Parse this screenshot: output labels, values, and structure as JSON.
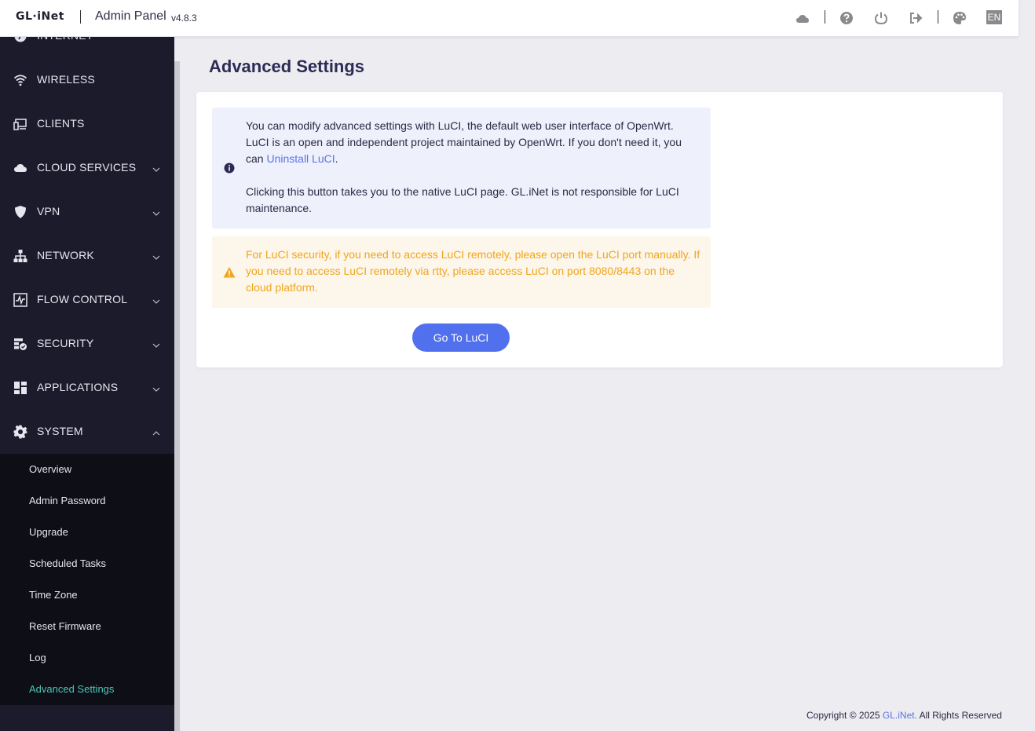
{
  "header": {
    "logo": "GL·iNet",
    "title": "Admin Panel",
    "version": "v4.8.3",
    "language": "EN"
  },
  "sidebar": {
    "items": [
      {
        "label": "INTERNET",
        "icon": "globe-icon",
        "has_chevron": false
      },
      {
        "label": "WIRELESS",
        "icon": "wifi-icon",
        "has_chevron": false
      },
      {
        "label": "CLIENTS",
        "icon": "devices-icon",
        "has_chevron": false
      },
      {
        "label": "CLOUD SERVICES",
        "icon": "cloud-icon",
        "has_chevron": true
      },
      {
        "label": "VPN",
        "icon": "shield-icon",
        "has_chevron": true
      },
      {
        "label": "NETWORK",
        "icon": "network-icon",
        "has_chevron": true
      },
      {
        "label": "FLOW CONTROL",
        "icon": "flow-icon",
        "has_chevron": true
      },
      {
        "label": "SECURITY",
        "icon": "firewall-icon",
        "has_chevron": true
      },
      {
        "label": "APPLICATIONS",
        "icon": "apps-icon",
        "has_chevron": true
      },
      {
        "label": "SYSTEM",
        "icon": "gear-icon",
        "has_chevron": true,
        "expanded": true
      }
    ],
    "system_submenu": [
      "Overview",
      "Admin Password",
      "Upgrade",
      "Scheduled Tasks",
      "Time Zone",
      "Reset Firmware",
      "Log",
      "Advanced Settings"
    ],
    "active_submenu": "Advanced Settings"
  },
  "main": {
    "title": "Advanced Settings",
    "info": {
      "p1_before": "You can modify advanced settings with LuCI, the default web user interface of OpenWrt. LuCI is an open and independent project maintained by OpenWrt. If you don't need it, you can ",
      "p1_link": "Uninstall LuCI",
      "p1_after": ".",
      "p2": "Clicking this button takes you to the native LuCI page. GL.iNet is not responsible for LuCI maintenance."
    },
    "warning": "For LuCI security, if you need to access LuCI remotely, please open the LuCI port manually. If you need to access LuCI remotely via rtty, please access LuCI on port 8080/8443 on the cloud platform.",
    "button": "Go To LuCI"
  },
  "footer": {
    "prefix": "Copyright © 2025 ",
    "link": "GL.iNet.",
    "suffix": " All Rights Reserved"
  },
  "colors": {
    "sidebar_bg": "#1b1b2b",
    "submenu_bg": "#0e0e17",
    "active_item": "#48c7b5",
    "primary": "#5070ee",
    "info_bg": "#eef0fb",
    "warning_bg": "#fdf6ea",
    "warning_text": "#f0a51e"
  }
}
